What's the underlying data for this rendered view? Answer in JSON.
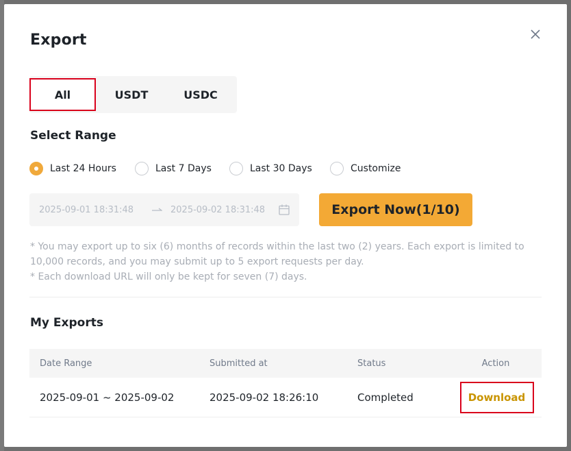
{
  "modal": {
    "title": "Export"
  },
  "tabs": [
    {
      "label": "All",
      "active": true
    },
    {
      "label": "USDT",
      "active": false
    },
    {
      "label": "USDC",
      "active": false
    }
  ],
  "range": {
    "title": "Select Range",
    "options": [
      {
        "label": "Last 24 Hours",
        "checked": true
      },
      {
        "label": "Last 7 Days",
        "checked": false
      },
      {
        "label": "Last 30 Days",
        "checked": false
      },
      {
        "label": "Customize",
        "checked": false
      }
    ],
    "start": "2025-09-01 18:31:48",
    "end": "2025-09-02 18:31:48"
  },
  "export_button": "Export Now(1/10)",
  "notes": {
    "line1": "* You may export up to six (6) months of records within the last two (2) years. Each export is limited to 10,000 records, and you may submit up to 5 export requests per day.",
    "line2": "* Each download URL will only be kept for seven (7) days."
  },
  "exports": {
    "title": "My Exports",
    "columns": [
      "Date Range",
      "Submitted at",
      "Status",
      "Action"
    ],
    "rows": [
      {
        "date_range": "2025-09-01 ~ 2025-09-02",
        "submitted_at": "2025-09-02 18:26:10",
        "status": "Completed",
        "action": "Download"
      }
    ]
  },
  "colors": {
    "accent": "#f3a935",
    "highlight": "#d9001b",
    "link": "#c99400"
  }
}
